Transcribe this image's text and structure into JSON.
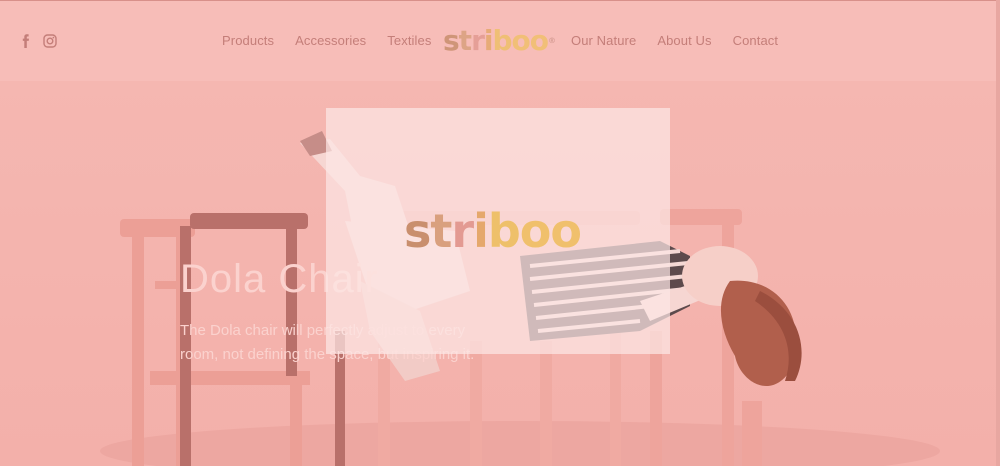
{
  "header": {
    "social": [
      {
        "name": "facebook-icon"
      },
      {
        "name": "instagram-icon"
      }
    ],
    "nav_left": [
      "Products",
      "Accessories",
      "Textiles"
    ],
    "nav_right": [
      "Our Nature",
      "About Us",
      "Contact"
    ],
    "logo": {
      "text": "striboo",
      "registered": "®"
    }
  },
  "hero": {
    "title": "Dola Chair",
    "description": "The Dola chair will perfectly adjust to every room, not defining the space, but inspiring it."
  },
  "loader": {
    "logo": "striboo"
  },
  "colors": {
    "overlay": "#f4b5b0",
    "nav_text": "#c47e79",
    "hero_text": "#fbd2ce"
  }
}
